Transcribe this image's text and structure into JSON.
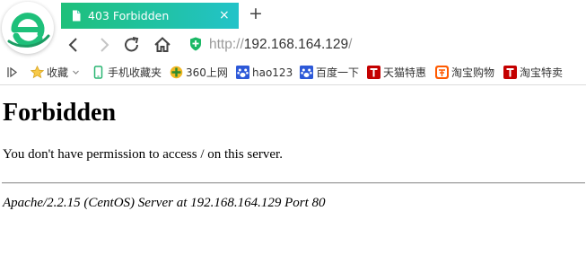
{
  "browser": {
    "logo_icon": "360-browser-e-logo",
    "accent": "#1ec07a",
    "tab": {
      "title": "403 Forbidden",
      "close": "×"
    },
    "new_tab": "+",
    "address": {
      "scheme": "http://",
      "host": "192.168.164.129",
      "trailing": "/"
    }
  },
  "bookmarks": [
    {
      "label": "收藏",
      "icon": "star-icon"
    },
    {
      "label": "手机收藏夹",
      "icon": "phone-icon"
    },
    {
      "label": "360上网",
      "icon": "360-icon"
    },
    {
      "label": "hao123",
      "icon": "paw-icon"
    },
    {
      "label": "百度一下",
      "icon": "paw-icon"
    },
    {
      "label": "天猫特惠",
      "icon": "tmall-icon"
    },
    {
      "label": "淘宝购物",
      "icon": "taobao-icon"
    },
    {
      "label": "淘宝特卖",
      "icon": "tmall-icon"
    }
  ],
  "page": {
    "heading": "Forbidden",
    "message": "You don't have permission to access / on this server.",
    "server_signature": "Apache/2.2.15 (CentOS) Server at 192.168.164.129 Port 80"
  }
}
